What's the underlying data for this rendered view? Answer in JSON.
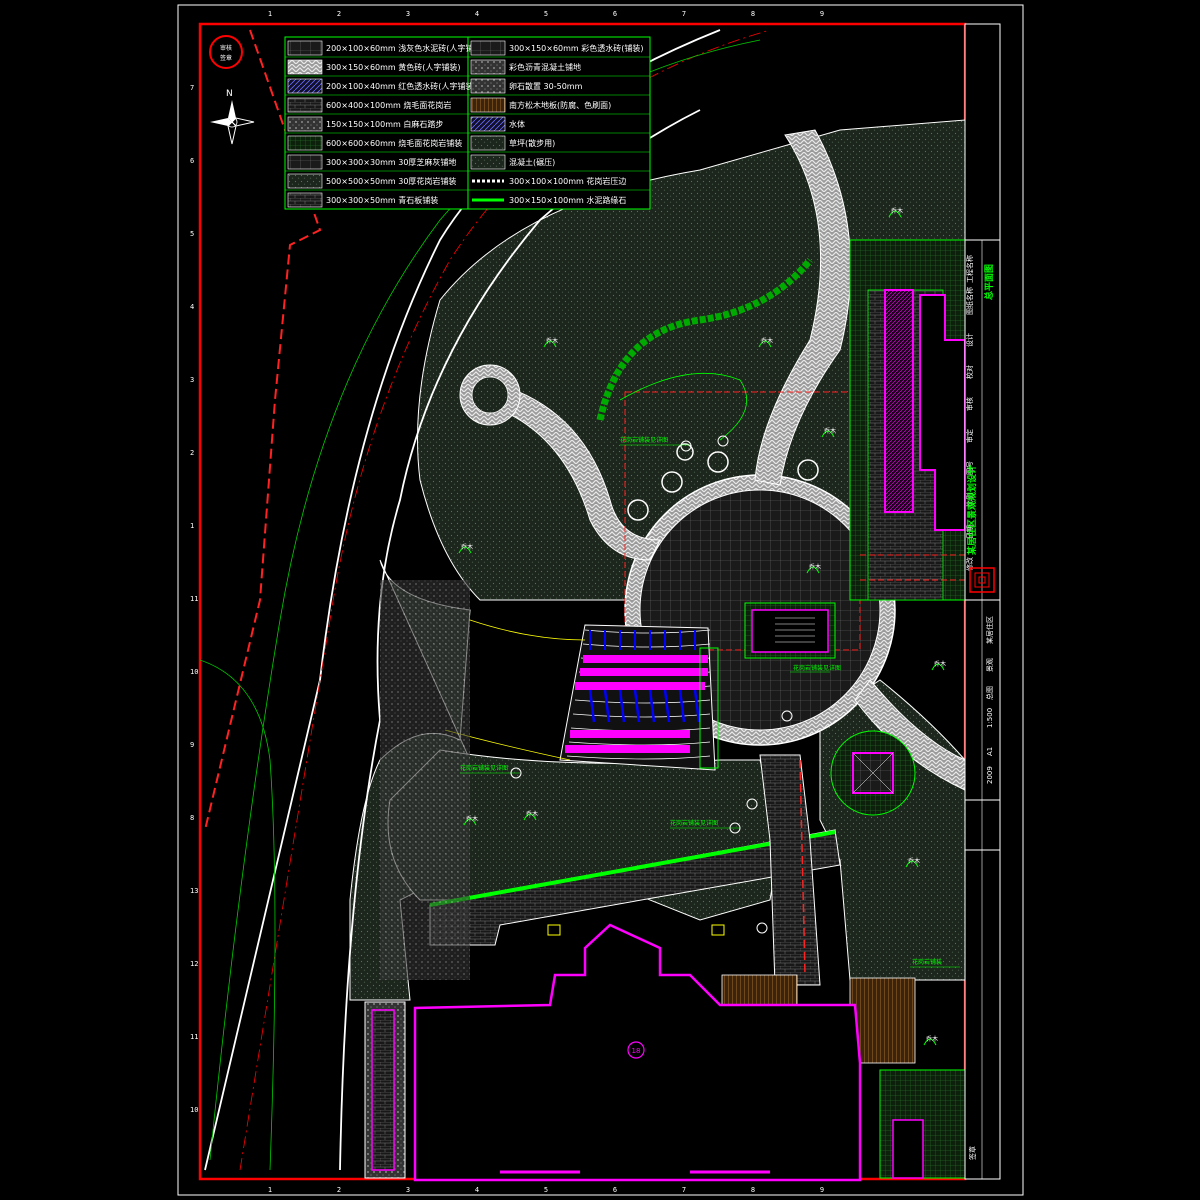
{
  "drawing": {
    "building_number": "18",
    "north_label": "N",
    "seal_text": [
      "审核",
      "签章"
    ]
  },
  "grid": {
    "top": [
      "1",
      "2",
      "3",
      "4",
      "5",
      "6",
      "7",
      "8",
      "9"
    ],
    "bottom": [
      "1",
      "2",
      "3",
      "4",
      "5",
      "6",
      "7",
      "8",
      "9"
    ],
    "left": [
      "7",
      "6",
      "5",
      "4",
      "3",
      "2",
      "1",
      "11",
      "10",
      "9",
      "8",
      "13",
      "12",
      "11",
      "10"
    ]
  },
  "legend": {
    "left": [
      "200×100×60mm 浅灰色水泥砖(人字铺装)",
      "300×150×60mm 黄色砖(人字铺装)",
      "200×100×40mm 红色透水砖(人字铺装)",
      "600×400×100mm 烧毛面花岗岩",
      "150×150×100mm 白麻石踏步",
      "600×600×60mm 烧毛面花岗岩铺装",
      "300×300×30mm 30厚芝麻灰铺地",
      "500×500×50mm 30厚花岗岩铺装",
      "300×300×50mm 青石板铺装"
    ],
    "right": [
      "300×150×60mm 彩色透水砖(铺装)",
      "彩色沥青混凝土铺地",
      "卵石散置 30-50mm",
      "南方松木地板(防腐、色刷面)",
      "水体",
      "草坪(散步用)",
      "混凝土(碾压)",
      "300×100×100mm 花岗岩压边",
      "300×150×100mm 水泥路缘石"
    ]
  },
  "annotations": {
    "a1": "花岗岩铺装见详图",
    "a2": "花岗岩铺装见详图",
    "a3": "花岗岩铺装见详图",
    "a4": "花岗岩铺装见详图",
    "a5": "花岗岩铺装"
  },
  "trees": [
    "乔木",
    "乔木",
    "乔木",
    "乔木",
    "乔木",
    "乔木",
    "乔木",
    "乔木",
    "乔木",
    "乔木",
    "乔木"
  ],
  "title_block": {
    "project_title": "某居住区景观规划设计",
    "drawing_title": "总平面图",
    "stamp": "签章",
    "cells": [
      "工程名称",
      "图纸名称",
      "设计",
      "校对",
      "审核",
      "审定",
      "图号",
      "比例",
      "日期",
      "修改"
    ],
    "values": [
      "某居住区",
      "景观",
      "总图",
      "1:500",
      "A1",
      "2009"
    ]
  },
  "colors": {
    "frame_red": "#ff0000",
    "line_green": "#00ff00",
    "magenta": "#ff00ff",
    "white": "#ffffff",
    "yellow": "#ffff00",
    "cyan": "#00ffff",
    "blue": "#0000ff",
    "lawn": "#222f22"
  }
}
